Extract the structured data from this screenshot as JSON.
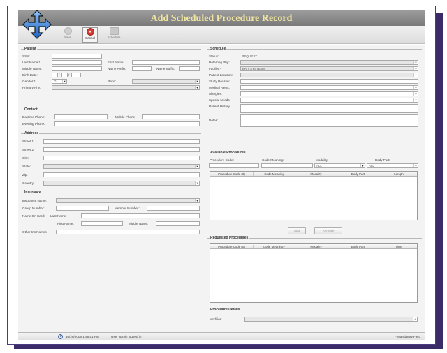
{
  "window": {
    "title": "Add Scheduled Procedure Record"
  },
  "toolbar": {
    "save_label": "Save",
    "cancel_label": "Cancel",
    "schedule_label": "Schedule"
  },
  "patient": {
    "section": "Patient",
    "ssn_label": "SSN:",
    "last_name_label": "Last Name:*",
    "first_name_label": "First Name:",
    "middle_name_label": "Middle Name:",
    "name_prefix_label": "Name Prefix:",
    "name_suffix_label": "Name Suffix:",
    "birth_date_label": "Birth Date:",
    "birth_date_sep1": "/",
    "birth_date_sep2": "/",
    "gender_label": "Gender:*",
    "gender_value": "O",
    "race_label": "Race:",
    "primary_phy_label": "Primary Phy:"
  },
  "contact": {
    "section": "Contact",
    "daytime_label": "Daytime Phone:",
    "mobile_label": "Mobile Phone:",
    "evening_label": "Evening Phone:"
  },
  "address": {
    "section": "Address",
    "street1_label": "Street 1:",
    "street2_label": "Street 2:",
    "city_label": "City:",
    "state_label": "State:",
    "zip_label": "Zip:",
    "country_label": "Country:"
  },
  "insurance": {
    "section": "Insurance",
    "name_label": "Insurance Name:",
    "group_label": "Group Number:",
    "member_label": "Member Number:",
    "name_on_card_label": "Name On Card:",
    "last_name_label": "Last Name:",
    "first_name_label": "First Name:",
    "middle_name_label": "Middle Name:",
    "other_ins_label": "Other Ins Names:"
  },
  "schedule": {
    "section": "Schedule",
    "status_label": "Status:",
    "status_value": "REQUEST",
    "referring_label": "Referring Phy:*",
    "facility_label": "Facility:*",
    "facility_value": "BRIT SYSTEMS",
    "patient_location_label": "Patient Location:",
    "study_reason_label": "Study Reason:",
    "medical_alerts_label": "Medical Alerts:",
    "allergies_label": "Allergies:",
    "special_needs_label": "Special Needs:",
    "patient_history_label": "Patient History:",
    "notes_label": "Notes:"
  },
  "available": {
    "section": "Available Procedures",
    "code_label": "Procedure Code:",
    "meaning_label": "Code Meaning:",
    "modality_label": "Modality:",
    "bodypart_label": "Body Part:",
    "modality_value": "ALL",
    "bodypart_value": "ALL",
    "columns": [
      "Procedure Code (0)",
      "Code Meaning",
      "Modality",
      "Body Part",
      "Length"
    ],
    "add_label": "Add",
    "remove_label": "Remove"
  },
  "requested": {
    "section": "Requested Procedures",
    "columns": [
      "Procedure Code (0)",
      "Code Meaning -",
      "Modality",
      "Body Part",
      "Time"
    ]
  },
  "details": {
    "section": "Procedure Details",
    "modifier_label": "Modifier:"
  },
  "status": {
    "timestamp": "10/26/2009  1:46:51 PM",
    "message": "User admin logged in",
    "mandatory": "* Mandatory Field"
  },
  "icons": {
    "logo": "four-way-arrow-icon",
    "save": "disk-icon",
    "cancel": "cancel-x-icon",
    "schedule": "calendar-icon",
    "info": "info-icon"
  },
  "colors": {
    "frame": "#3a2a68",
    "title_text": "#efe5a0",
    "cancel_red": "#d93a2f",
    "logo_blue": "#2f7fd6"
  }
}
